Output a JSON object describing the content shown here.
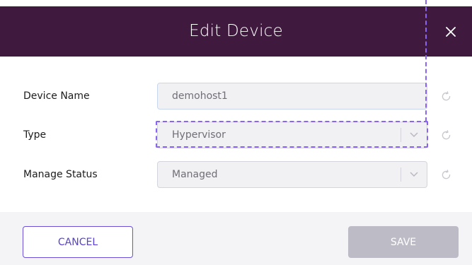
{
  "dialog": {
    "title": "Edit Device",
    "close_icon": "close-icon"
  },
  "form": {
    "fields": [
      {
        "label": "Device Name",
        "value": "demohost1",
        "kind": "text"
      },
      {
        "label": "Type",
        "value": "Hypervisor",
        "kind": "select"
      },
      {
        "label": "Manage Status",
        "value": "Managed",
        "kind": "select"
      }
    ],
    "reset_icon": "refresh-icon"
  },
  "footer": {
    "cancel_label": "CANCEL",
    "save_label": "SAVE"
  },
  "colors": {
    "header_bg": "#3f1a3e",
    "accent": "#6b4fd8",
    "highlight_dash": "#8a66f0",
    "disabled_button": "#bdbcc6"
  }
}
